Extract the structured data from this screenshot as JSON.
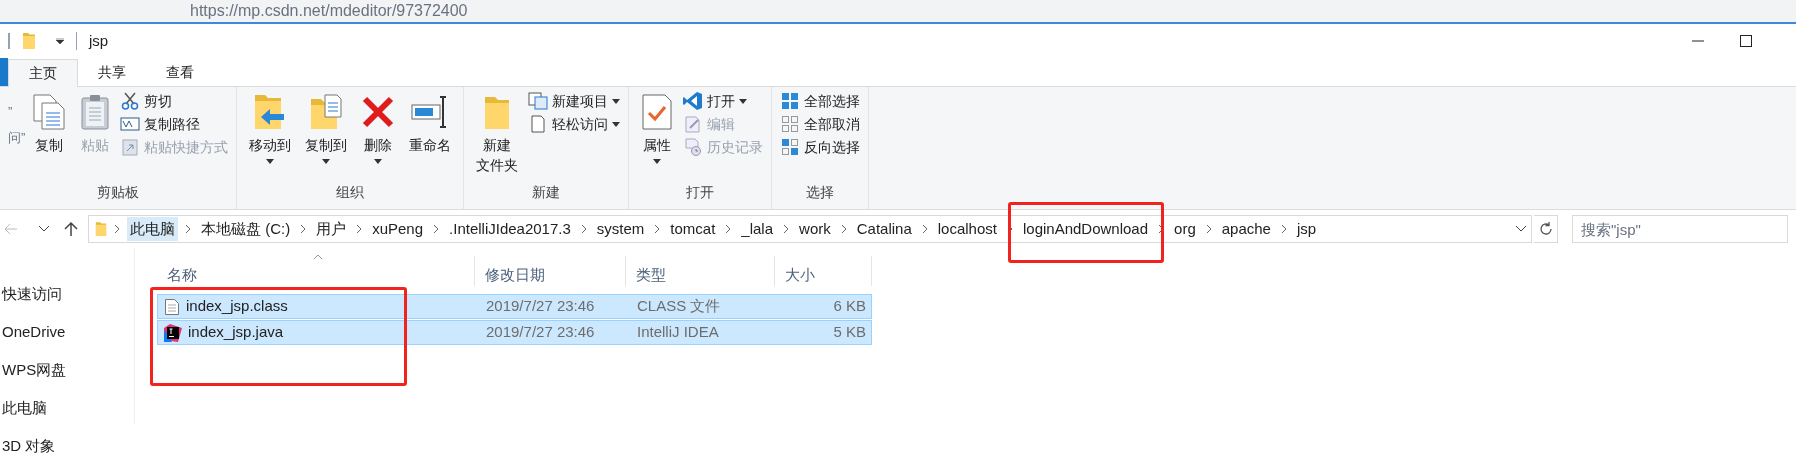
{
  "browser": {
    "url": "https://mp.csdn.net/mdeditor/97372400"
  },
  "window": {
    "title": "jsp"
  },
  "tabs": [
    {
      "label": "主页",
      "selected": true
    },
    {
      "label": "共享",
      "selected": false
    },
    {
      "label": "查看",
      "selected": false
    }
  ],
  "ribbon": {
    "groups": [
      {
        "label": "剪贴板",
        "columns": [
          {
            "kind": "cut",
            "lines": [
              "”",
              "问”"
            ]
          },
          {
            "kind": "large",
            "lines": [
              "复制"
            ],
            "caret": false,
            "disabled": false
          },
          {
            "kind": "large",
            "lines": [
              "粘贴"
            ],
            "caret": false,
            "disabled": true
          },
          {
            "kind": "stack",
            "items": [
              {
                "label": "剪切",
                "caret": false,
                "disabled": false
              },
              {
                "label": "复制路径",
                "caret": false,
                "disabled": false
              },
              {
                "label": "粘贴快捷方式",
                "caret": false,
                "disabled": true
              }
            ]
          }
        ]
      },
      {
        "label": "组织",
        "columns": [
          {
            "kind": "large",
            "lines": [
              "移动到"
            ],
            "caret": true,
            "disabled": false
          },
          {
            "kind": "large",
            "lines": [
              "复制到"
            ],
            "caret": true,
            "disabled": false
          },
          {
            "kind": "large",
            "lines": [
              "删除"
            ],
            "caret": true,
            "disabled": false
          },
          {
            "kind": "large",
            "lines": [
              "重命名"
            ],
            "caret": false,
            "disabled": false
          }
        ]
      },
      {
        "label": "新建",
        "columns": [
          {
            "kind": "large",
            "lines": [
              "新建",
              "文件夹"
            ],
            "caret": false,
            "disabled": false
          },
          {
            "kind": "stack",
            "items": [
              {
                "label": "新建项目",
                "caret": true,
                "disabled": false
              },
              {
                "label": "轻松访问",
                "caret": true,
                "disabled": false
              }
            ]
          }
        ]
      },
      {
        "label": "打开",
        "columns": [
          {
            "kind": "large",
            "lines": [
              "属性"
            ],
            "caret": true,
            "disabled": false
          },
          {
            "kind": "stack",
            "items": [
              {
                "label": "打开",
                "caret": true,
                "disabled": false
              },
              {
                "label": "编辑",
                "caret": false,
                "disabled": true
              },
              {
                "label": "历史记录",
                "caret": false,
                "disabled": true
              }
            ]
          }
        ]
      },
      {
        "label": "选择",
        "columns": [
          {
            "kind": "stack",
            "items": [
              {
                "label": "全部选择",
                "caret": false,
                "disabled": false
              },
              {
                "label": "全部取消",
                "caret": false,
                "disabled": false
              },
              {
                "label": "反向选择",
                "caret": false,
                "disabled": false
              }
            ]
          }
        ]
      }
    ]
  },
  "address_bar": {
    "back_disabled": true,
    "crumbs": [
      {
        "label": "此电脑",
        "selected": true
      },
      {
        "label": "本地磁盘 (C:)",
        "selected": false
      },
      {
        "label": "用户",
        "selected": false
      },
      {
        "label": "xuPeng",
        "selected": false
      },
      {
        "label": ".IntelliJIdea2017.3",
        "selected": false
      },
      {
        "label": "system",
        "selected": false
      },
      {
        "label": "tomcat",
        "selected": false
      },
      {
        "label": "_lala",
        "selected": false
      },
      {
        "label": "work",
        "selected": false
      },
      {
        "label": "Catalina",
        "selected": false
      },
      {
        "label": "localhost",
        "selected": false
      },
      {
        "label": "loginAndDownload",
        "selected": false
      },
      {
        "label": "org",
        "selected": false
      },
      {
        "label": "apache",
        "selected": false
      },
      {
        "label": "jsp",
        "selected": false
      }
    ],
    "search": {
      "placeholder": "搜索\"jsp\""
    }
  },
  "nav_pane": {
    "items": [
      "快速访问",
      "OneDrive",
      "WPS网盘",
      "此电脑",
      "3D 对象"
    ]
  },
  "file_list": {
    "columns": [
      "名称",
      "修改日期",
      "类型",
      "大小"
    ],
    "rows": [
      {
        "kind": "text-file",
        "name": "index_jsp.class",
        "date": "2019/7/27 23:46",
        "type": "CLASS 文件",
        "size": "6 KB",
        "selected": true
      },
      {
        "kind": "idea-file",
        "name": "index_jsp.java",
        "date": "2019/7/27 23:46",
        "type": "IntelliJ IDEA",
        "size": "5 KB",
        "selected": true
      }
    ]
  }
}
